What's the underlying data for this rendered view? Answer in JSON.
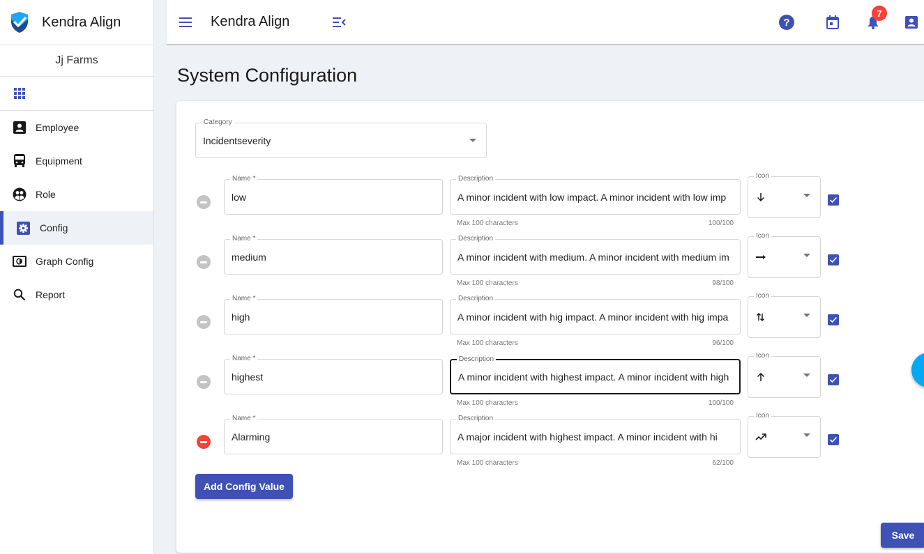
{
  "sidebar": {
    "brand": "Kendra Align",
    "organization": "Jj Farms",
    "apps_icon": "apps-grid-icon",
    "items": [
      {
        "label": "Employee",
        "icon": "badge-icon",
        "active": false
      },
      {
        "label": "Equipment",
        "icon": "bus-icon",
        "active": false
      },
      {
        "label": "Role",
        "icon": "group-icon",
        "active": false
      },
      {
        "label": "Config",
        "icon": "settings-icon",
        "active": true
      },
      {
        "label": "Graph Config",
        "icon": "graph-config-icon",
        "active": false
      },
      {
        "label": "Report",
        "icon": "search-icon",
        "active": false
      }
    ]
  },
  "topbar": {
    "title": "Kendra Align",
    "icons": [
      "menu-icon",
      "menu-collapse-icon",
      "help-icon",
      "calendar-icon",
      "bell-icon",
      "account-icon"
    ],
    "notification_count": "7"
  },
  "page": {
    "title": "System Configuration"
  },
  "category": {
    "label": "Category",
    "value": "Incidentseverity"
  },
  "labels": {
    "name": "Name *",
    "description": "Description",
    "icon": "Icon",
    "helper": "Max 100 characters"
  },
  "rows": [
    {
      "name": "low",
      "description": "A minor incident with low impact.  A minor incident with low imp",
      "count": "100/100",
      "icon": "arrow-downward-icon",
      "checked": true,
      "removable": false
    },
    {
      "name": "medium",
      "description": "A minor incident with medium. A minor incident with medium im",
      "count": "98/100",
      "icon": "arrow-right-icon",
      "checked": true,
      "removable": false
    },
    {
      "name": "high",
      "description": "A minor incident with hig impact. A minor incident with hig impa",
      "count": "96/100",
      "icon": "swap-vert-icon",
      "checked": true,
      "removable": false
    },
    {
      "name": "highest",
      "description": "A minor incident with highest impact. A minor incident with high",
      "count": "100/100",
      "icon": "arrow-upward-icon",
      "checked": true,
      "removable": false,
      "focused": true
    },
    {
      "name": "Alarming",
      "description": "A major incident with highest impact. A minor incident with hi",
      "count": "62/100",
      "icon": "trending-up-icon",
      "checked": true,
      "removable": true
    }
  ],
  "actions": {
    "add": "Add Config Value",
    "save": "Save"
  },
  "colors": {
    "primary": "#3f51b5",
    "danger": "#f44336",
    "fab": "#03a9f4",
    "page_bg": "#eef1f5"
  }
}
